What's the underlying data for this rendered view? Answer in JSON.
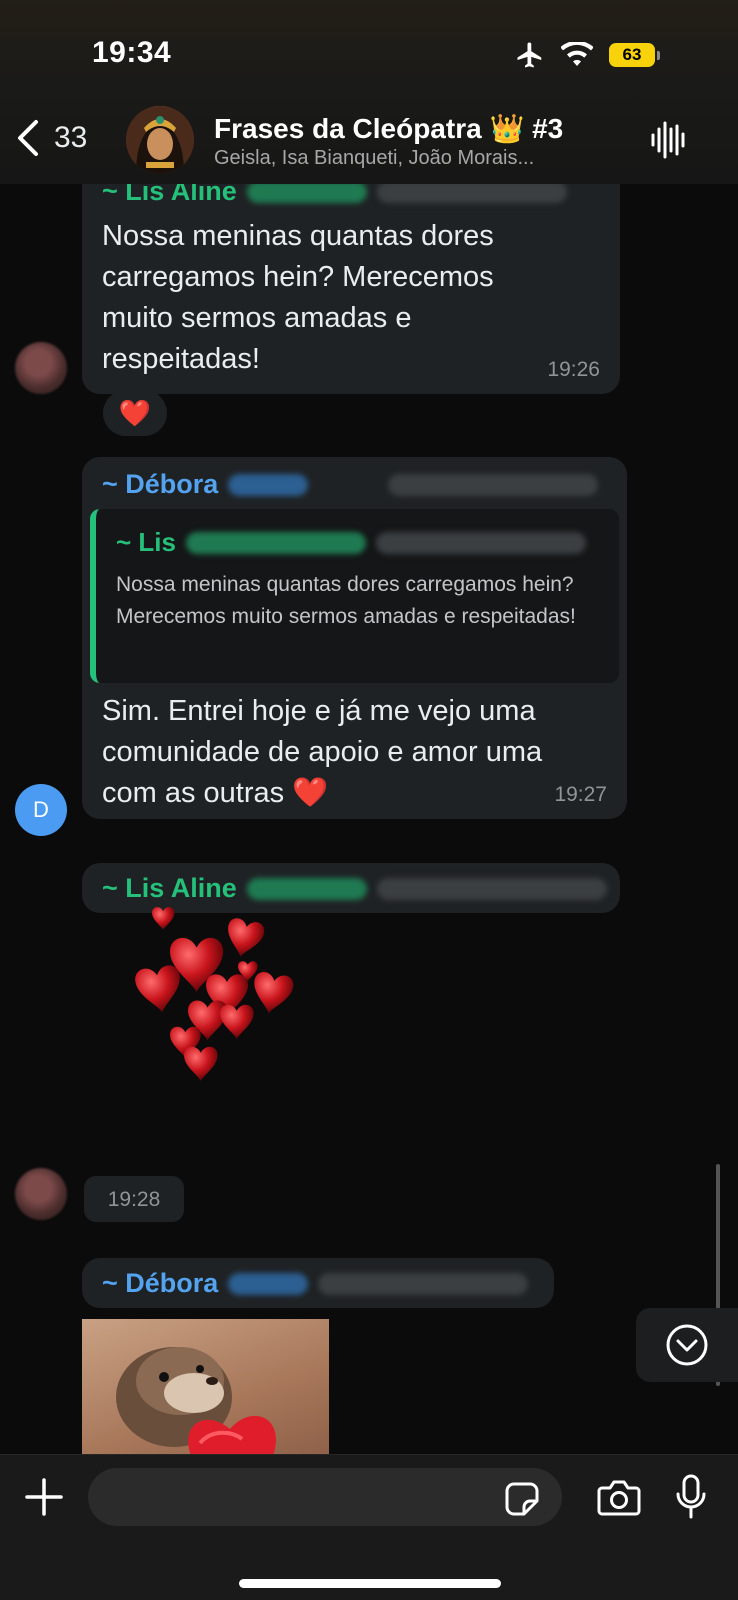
{
  "status_bar": {
    "time": "19:34",
    "battery": "63",
    "icons": [
      "airplane-icon",
      "wifi-icon",
      "battery-icon"
    ]
  },
  "header": {
    "back_count": "33",
    "title": "Frases da Cleópatra 👑 #3",
    "subtitle": "Geisla, Isa Bianqueti, João Morais..."
  },
  "messages": [
    {
      "sender": "~ Lis Aline",
      "text": "Nossa meninas quantas dores carregamos hein? Merecemos muito sermos amadas e respeitadas!",
      "time": "19:26",
      "reaction": "❤️"
    },
    {
      "sender": "~ Débora",
      "avatar_initial": "D",
      "quote": {
        "sender": "~ Lis",
        "text": "Nossa meninas quantas dores carregamos hein? Merecemos muito sermos amadas e respeitadas!"
      },
      "text": "Sim. Entrei hoje e já me vejo uma comunidade de apoio e amor uma com as outras ❤️",
      "time": "19:27"
    },
    {
      "sender": "~ Lis Aline",
      "sticker": "red-hearts-sticker",
      "time": "19:28"
    },
    {
      "sender": "~ Débora",
      "image": "otter-with-heart-image"
    }
  ],
  "input": {
    "placeholder": ""
  },
  "colors": {
    "green_sender": "#25c07a",
    "blue_sender": "#53a3f0",
    "bubble": "#1f2224",
    "background": "#0b0b0b",
    "battery": "#f8d30c"
  }
}
